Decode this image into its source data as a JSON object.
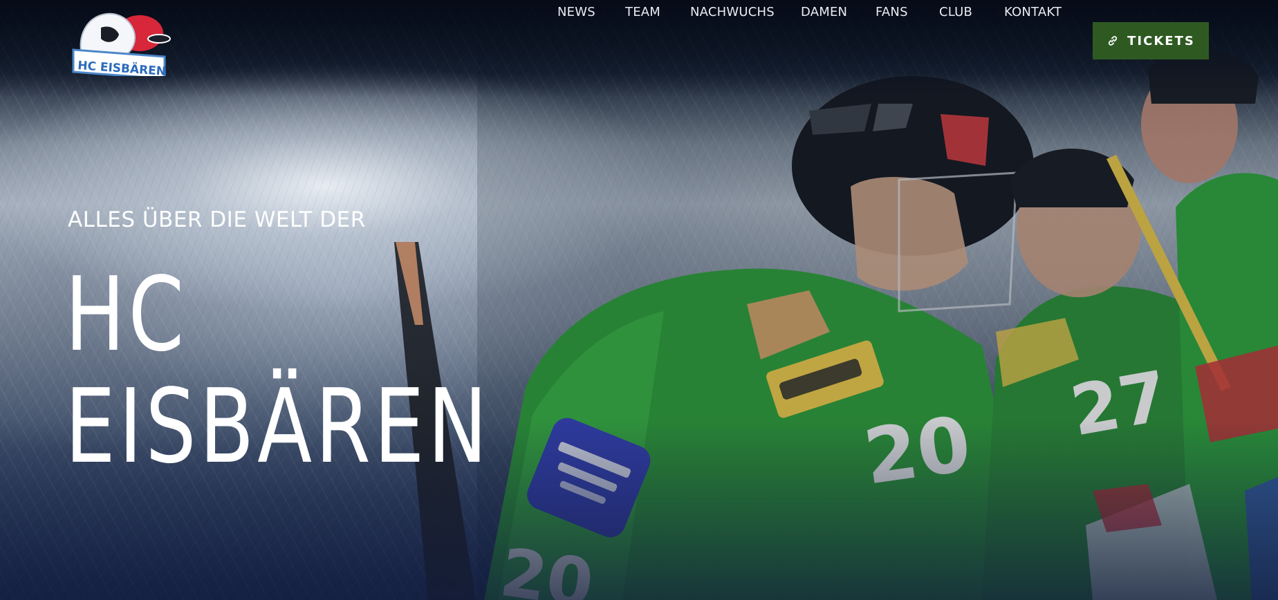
{
  "header": {
    "logo_text": "HC EISBÄREN",
    "nav": [
      {
        "label": "NEWS"
      },
      {
        "label": "TEAM"
      },
      {
        "label": "NACHWUCHS"
      },
      {
        "label": "DAMEN"
      },
      {
        "label": "FANS"
      },
      {
        "label": "CLUB"
      },
      {
        "label": "KONTAKT"
      }
    ],
    "tickets_label": "TICKETS",
    "tickets_icon": "link-icon"
  },
  "hero": {
    "kicker": "ALLES ÜBER DIE WELT DER",
    "title_line_1": "HC",
    "title_line_2": "EISBÄREN"
  },
  "colors": {
    "tickets_button": "#2e5a22",
    "jersey_green": "#2f9a3a",
    "text": "#ffffff"
  }
}
